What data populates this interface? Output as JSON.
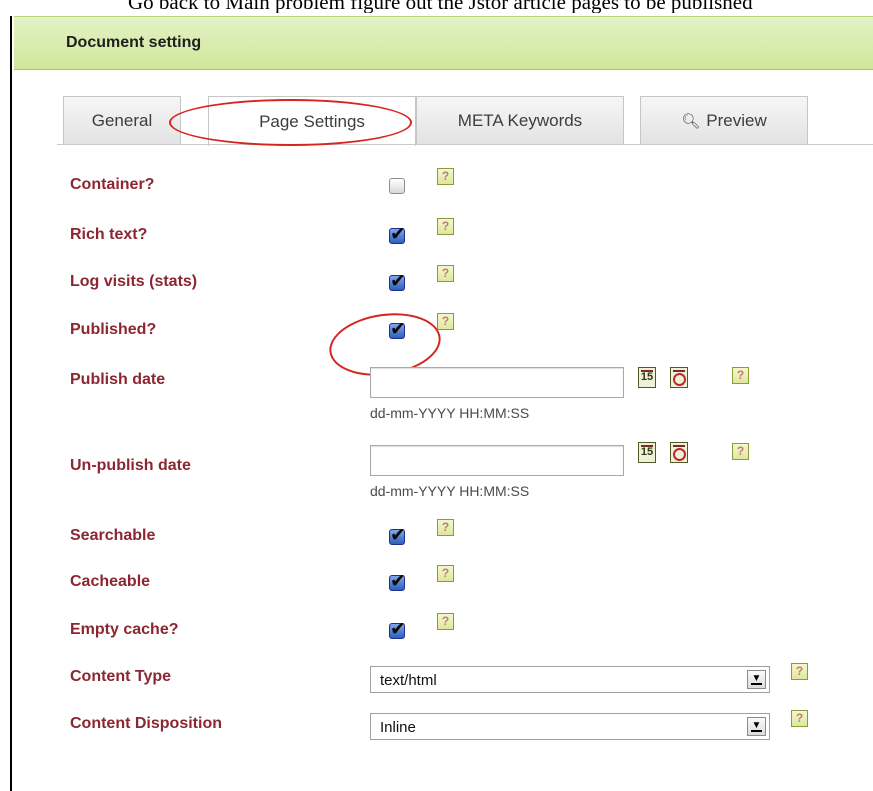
{
  "cutoff_text": "Go back to Main problem figure out the Jstor article pages to be published",
  "panel_title": "Document setting",
  "tabs": [
    {
      "label": "General"
    },
    {
      "label": "Page Settings"
    },
    {
      "label": "META Keywords"
    },
    {
      "label": "Preview",
      "icon": "magnifier-icon"
    }
  ],
  "active_tab": "Page Settings",
  "help_glyph": "?",
  "fields": {
    "container": {
      "label": "Container?",
      "checked": false
    },
    "rich_text": {
      "label": "Rich text?",
      "checked": true
    },
    "log_visits": {
      "label": "Log visits (stats)",
      "checked": true
    },
    "published": {
      "label": "Published?",
      "checked": true
    },
    "publish_date": {
      "label": "Publish date",
      "value": "",
      "hint": "dd-mm-YYYY HH:MM:SS",
      "calendar_glyph": "15"
    },
    "unpublish_date": {
      "label": "Un-publish date",
      "value": "",
      "hint": "dd-mm-YYYY HH:MM:SS",
      "calendar_glyph": "15"
    },
    "searchable": {
      "label": "Searchable",
      "checked": true
    },
    "cacheable": {
      "label": "Cacheable",
      "checked": true
    },
    "empty_cache": {
      "label": "Empty cache?",
      "checked": true
    },
    "content_type": {
      "label": "Content Type",
      "value": "text/html"
    },
    "content_disposition": {
      "label": "Content Disposition",
      "value": "Inline"
    }
  },
  "colors": {
    "label": "#8b2632",
    "header_bg": "#cfe799",
    "annotation": "#d6251f"
  }
}
